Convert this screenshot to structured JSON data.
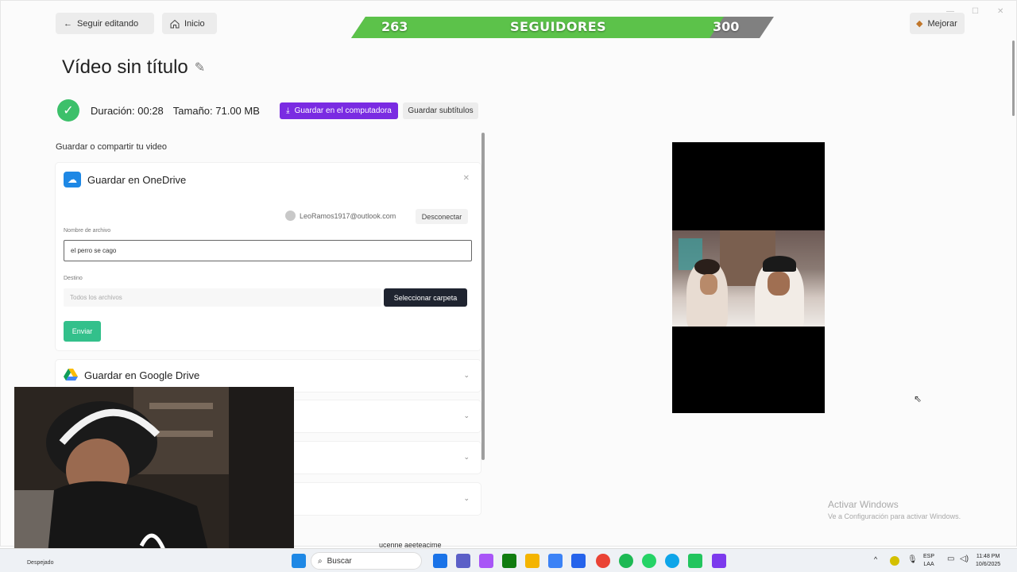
{
  "topbar": {
    "back_label": "Seguir editando",
    "home_label": "Inicio",
    "upgrade_label": "Mejorar"
  },
  "followers": {
    "current": "263",
    "title": "SEGUIDORES",
    "goal": "300",
    "progress": 0.877
  },
  "page": {
    "title": "Vídeo sin título"
  },
  "status": {
    "duration": "Duración: 00:28",
    "size": "Tamaño: 71.00 MB",
    "save_pc_label": "Guardar en el computadora",
    "save_subs_label": "Guardar subtítulos"
  },
  "share": {
    "section_label": "Guardar o compartir tu video",
    "onedrive": {
      "title": "Guardar en OneDrive",
      "account": "LeoRamos1917@outlook.com",
      "disconnect_label": "Desconectar",
      "filename_label": "Nombre de archivo",
      "filename_value": "el perro se cago",
      "dest_label": "Destino",
      "dest_placeholder": "Todos los archivos",
      "select_folder_label": "Seleccionar carpeta",
      "send_label": "Enviar"
    },
    "gdrive": {
      "title": "Guardar en Google Drive"
    }
  },
  "watermark": {
    "line1": "Activar Windows",
    "line2": "Ve a Configuración para activar Windows."
  },
  "overlay_text": "ucenne aeeteacime",
  "taskbar": {
    "weather": "Despejado",
    "search_label": "Buscar",
    "lang_line1": "ESP",
    "lang_line2": "LAA",
    "time": "11:48 PM",
    "date": "10/6/2025"
  },
  "colors": {
    "accent_purple": "#7a2be2",
    "success_green": "#3cc06a",
    "send_green": "#33c08b",
    "follower_green": "#5cc24a"
  }
}
